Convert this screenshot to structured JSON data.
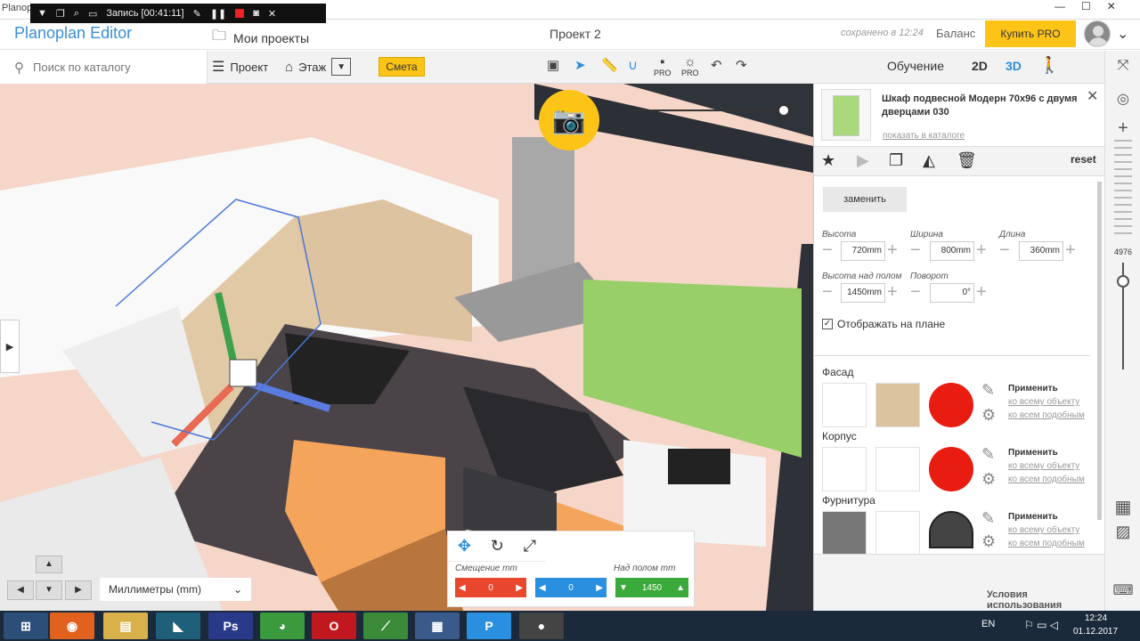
{
  "window": {
    "title": "Planoplan Editor",
    "controls": [
      "—",
      "☐",
      "✕"
    ]
  },
  "recorder": {
    "label": "Запись [00:41:11]"
  },
  "header": {
    "brand": "Planoplan Editor",
    "my_projects": "Мои проекты",
    "project_name": "Проект 2",
    "saved": "сохранено в 12:24",
    "balance": "Баланс",
    "buy_pro": "Купить PRO"
  },
  "toolbar": {
    "search_placeholder": "Поиск по каталогу",
    "project": "Проект",
    "floor": "Этаж",
    "estimate": "Смета",
    "pro1": "PRO",
    "pro2": "PRO",
    "learn": "Обучение",
    "view2d": "2D",
    "view3d": "3D"
  },
  "item": {
    "title": "Шкаф подвесной Модерн 70x96 с двумя дверцами 030",
    "show_in_catalog": "показать в каталоге",
    "reset": "reset",
    "replace": "заменить",
    "height_label": "Высота",
    "height_value": "720mm",
    "width_label": "Ширина",
    "width_value": "800mm",
    "length_label": "Длина",
    "length_value": "360mm",
    "elevation_label": "Высота над полом",
    "elevation_value": "1450mm",
    "rotation_label": "Поворот",
    "rotation_value": "0°",
    "show_on_plan": "Отображать на плане"
  },
  "materials": [
    {
      "name": "Фасад",
      "apply": "Применить",
      "link1": "ко всему объекту",
      "link2": "ко всем подобным",
      "color": "#e91c12"
    },
    {
      "name": "Корпус",
      "apply": "Применить",
      "link1": "ко всему объекту",
      "link2": "ко всем подобным",
      "color": "#e91c12"
    },
    {
      "name": "Фурнитура",
      "apply": "Применить",
      "link1": "ко всему объекту",
      "link2": "ко всем подобным",
      "color": "#444444"
    }
  ],
  "terms": "Условия использования",
  "zoom_value": "4976",
  "units": "Миллиметры (mm)",
  "transform": {
    "offset_label": "Смещение",
    "offset_unit": "mm",
    "floor_label": "Над полом",
    "floor_unit": "mm",
    "x": "0",
    "y": "0",
    "z": "1450"
  },
  "taskbar": {
    "lang": "EN",
    "time": "12:24",
    "date": "01.12.2017"
  }
}
